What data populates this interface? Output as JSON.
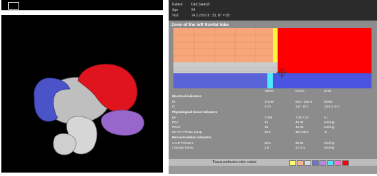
{
  "patient": {
    "label_patient": "Patient",
    "value_patient": "DECSAAS8",
    "label_age": "Age",
    "value_age": "34",
    "label_visit": "Visit",
    "value_visit": "14.2.2010 8 : 23, N° = 58"
  },
  "zone": {
    "title": "Zone of the left frontal lobe"
  },
  "table": {
    "headers": {
      "values": "Values",
      "norms": "Norms",
      "units": "Units"
    },
    "rows": [
      {
        "name": "Electrical indicators",
        "section": true
      },
      {
        "name": "IR",
        "value": "270.90",
        "norm": "93.6 - 282.9",
        "unit": "KOhm"
      },
      {
        "name": "IC",
        "value": "3.70",
        "norm": "3.5 - 10.7",
        "unit": "10-5 S.m-1"
      },
      {
        "name": "Physiological tissue indicators",
        "section": true
      },
      {
        "name": "pH",
        "value": "7.299",
        "norm": "7.26-7.34",
        "unit": "U.I"
      },
      {
        "name": "PO2",
        "value": "45",
        "norm": "40-46",
        "unit": "mm/Hg"
      },
      {
        "name": "PCO2",
        "value": "38",
        "norm": "44-48",
        "unit": "mm/Hg"
      },
      {
        "name": "Na+/K+ATPase pump",
        "value": "45.0",
        "norm": "45.0-55.0",
        "unit": "%"
      },
      {
        "name": "Microcirculation indicators",
        "section": true
      },
      {
        "name": "A.C.R Pressure",
        "value": "36.6",
        "norm": "30-34",
        "unit": "mm/Hg"
      },
      {
        "name": "I Oncotic forces",
        "value": "2.6",
        "norm": "3.1-3.5",
        "unit": "mm/Hg"
      }
    ]
  },
  "legend": {
    "label": "Tissue perfusion color coded",
    "colors": [
      "#ffff66",
      "#f6b58f",
      "#d9d9d9",
      "#6b73d6",
      "#b08de0",
      "#4fe0ff",
      "#ff6bd9",
      "#ff0000"
    ]
  },
  "colors": {
    "frontal_lobe": "#e0141e",
    "temporal_lobe": "#9966cc",
    "occipital_lobe": "#4a54c8",
    "map_red": "#ff0000",
    "map_salmon": "#f6a67a",
    "map_gray": "#cbcbcb",
    "map_blue": "#5a64d8",
    "map_yellow": "#fff23a",
    "map_cyan": "#4ee8ff"
  }
}
